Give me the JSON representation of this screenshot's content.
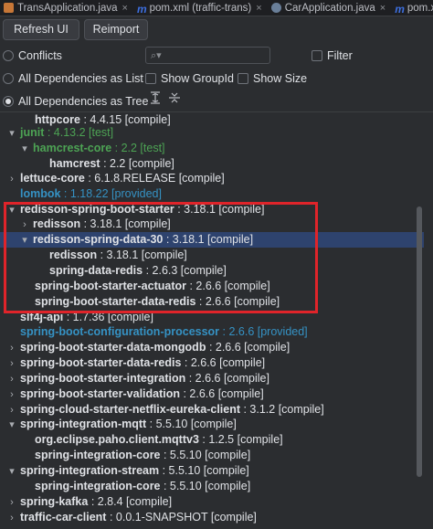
{
  "tabs": [
    {
      "label": "TransApplication.java",
      "icon": "java-class-icon"
    },
    {
      "label": "pom.xml (traffic-trans)",
      "icon": "maven-icon"
    },
    {
      "label": "CarApplication.java",
      "icon": "java-app-icon"
    },
    {
      "label": "pom.xml (traffic-",
      "icon": "maven-icon"
    }
  ],
  "toolbar": {
    "refresh_label": "Refresh UI",
    "reimport_label": "Reimport"
  },
  "options": {
    "conflicts": "Conflicts",
    "filter": "Filter",
    "all_deps_list": "All Dependencies as List",
    "show_groupid": "Show GroupId",
    "show_size": "Show Size",
    "all_deps_tree": "All Dependencies as Tree",
    "search_placeholder": ""
  },
  "tree": [
    {
      "name": "httpcore",
      "ver": " : 4.4.15 [compile]",
      "style": "plain",
      "arrow": ""
    },
    {
      "name": "junit",
      "ver": " : 4.13.2 [test]",
      "style": "green",
      "arrow": "▾"
    },
    {
      "name": "hamcrest-core",
      "ver": " : 2.2 [test]",
      "style": "green",
      "arrow": "▾"
    },
    {
      "name": "hamcrest",
      "ver": " : 2.2 [compile]",
      "style": "plain",
      "arrow": ""
    },
    {
      "name": "lettuce-core",
      "ver": " : 6.1.8.RELEASE [compile]",
      "style": "plain",
      "arrow": "›"
    },
    {
      "name": "lombok",
      "ver": " : 1.18.22 [provided]",
      "style": "blue",
      "arrow": ""
    },
    {
      "name": "redisson-spring-boot-starter",
      "ver": " : 3.18.1 [compile]",
      "style": "plain",
      "arrow": "▾"
    },
    {
      "name": "redisson",
      "ver": " : 3.18.1 [compile]",
      "style": "plain",
      "arrow": "›"
    },
    {
      "name": "redisson-spring-data-30",
      "ver": " : 3.18.1 [compile]",
      "style": "plain",
      "arrow": "▾"
    },
    {
      "name": "redisson",
      "ver": " : 3.18.1 [compile]",
      "style": "plain",
      "arrow": ""
    },
    {
      "name": "spring-data-redis",
      "ver": " : 2.6.3 [compile]",
      "style": "plain",
      "arrow": ""
    },
    {
      "name": "spring-boot-starter-actuator",
      "ver": " : 2.6.6 [compile]",
      "style": "plain",
      "arrow": ""
    },
    {
      "name": "spring-boot-starter-data-redis",
      "ver": " : 2.6.6 [compile]",
      "style": "plain",
      "arrow": ""
    },
    {
      "name": "slf4j-api",
      "ver": " : 1.7.36 [compile]",
      "style": "plain",
      "arrow": ""
    },
    {
      "name": "spring-boot-configuration-processor",
      "ver": " : 2.6.6 [provided]",
      "style": "blue",
      "arrow": ""
    },
    {
      "name": "spring-boot-starter-data-mongodb",
      "ver": " : 2.6.6 [compile]",
      "style": "plain",
      "arrow": "›"
    },
    {
      "name": "spring-boot-starter-data-redis",
      "ver": " : 2.6.6 [compile]",
      "style": "plain",
      "arrow": "›"
    },
    {
      "name": "spring-boot-starter-integration",
      "ver": " : 2.6.6 [compile]",
      "style": "plain",
      "arrow": "›"
    },
    {
      "name": "spring-boot-starter-validation",
      "ver": " : 2.6.6 [compile]",
      "style": "plain",
      "arrow": "›"
    },
    {
      "name": "spring-cloud-starter-netflix-eureka-client",
      "ver": " : 3.1.2 [compile]",
      "style": "plain",
      "arrow": "›"
    },
    {
      "name": "spring-integration-mqtt",
      "ver": " : 5.5.10 [compile]",
      "style": "plain",
      "arrow": "▾"
    },
    {
      "name": "org.eclipse.paho.client.mqttv3",
      "ver": " : 1.2.5 [compile]",
      "style": "plain",
      "arrow": ""
    },
    {
      "name": "spring-integration-core",
      "ver": " : 5.5.10 [compile]",
      "style": "plain",
      "arrow": ""
    },
    {
      "name": "spring-integration-stream",
      "ver": " : 5.5.10 [compile]",
      "style": "plain",
      "arrow": "▾"
    },
    {
      "name": "spring-integration-core",
      "ver": " : 5.5.10 [compile]",
      "style": "plain",
      "arrow": ""
    },
    {
      "name": "spring-kafka",
      "ver": " : 2.8.4 [compile]",
      "style": "plain",
      "arrow": "›"
    },
    {
      "name": "traffic-car-client",
      "ver": " : 0.0.1-SNAPSHOT [compile]",
      "style": "plain",
      "arrow": "›"
    }
  ],
  "colors": {
    "selection": "#2e436e",
    "highlight_box": "#e0242a",
    "test_scope": "#4da354",
    "provided_scope": "#3592c4"
  }
}
